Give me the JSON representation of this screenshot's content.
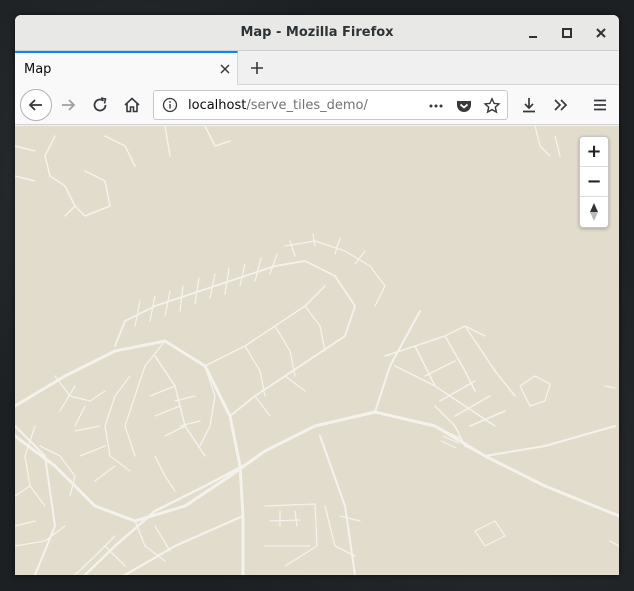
{
  "window": {
    "title": "Map - Mozilla Firefox"
  },
  "tabs": [
    {
      "label": "Map"
    }
  ],
  "urlbar": {
    "host": "localhost",
    "path": "/serve_tiles_demo/"
  },
  "map": {
    "background_color": "#e1dccb",
    "road_color": "#f4f2ec",
    "zoom_in_label": "+",
    "zoom_out_label": "−"
  },
  "icons": {
    "minimize": "minimize-icon",
    "maximize": "maximize-icon",
    "close": "close-icon",
    "back": "back-arrow-icon",
    "forward": "forward-arrow-icon",
    "reload": "reload-icon",
    "home": "home-icon",
    "info": "info-icon",
    "page_actions": "ellipsis-icon",
    "pocket": "pocket-icon",
    "bookmark": "star-icon",
    "downloads": "download-icon",
    "overflow": "chevrons-right-icon",
    "menu": "hamburger-menu-icon",
    "reset_north": "compass-icon"
  }
}
